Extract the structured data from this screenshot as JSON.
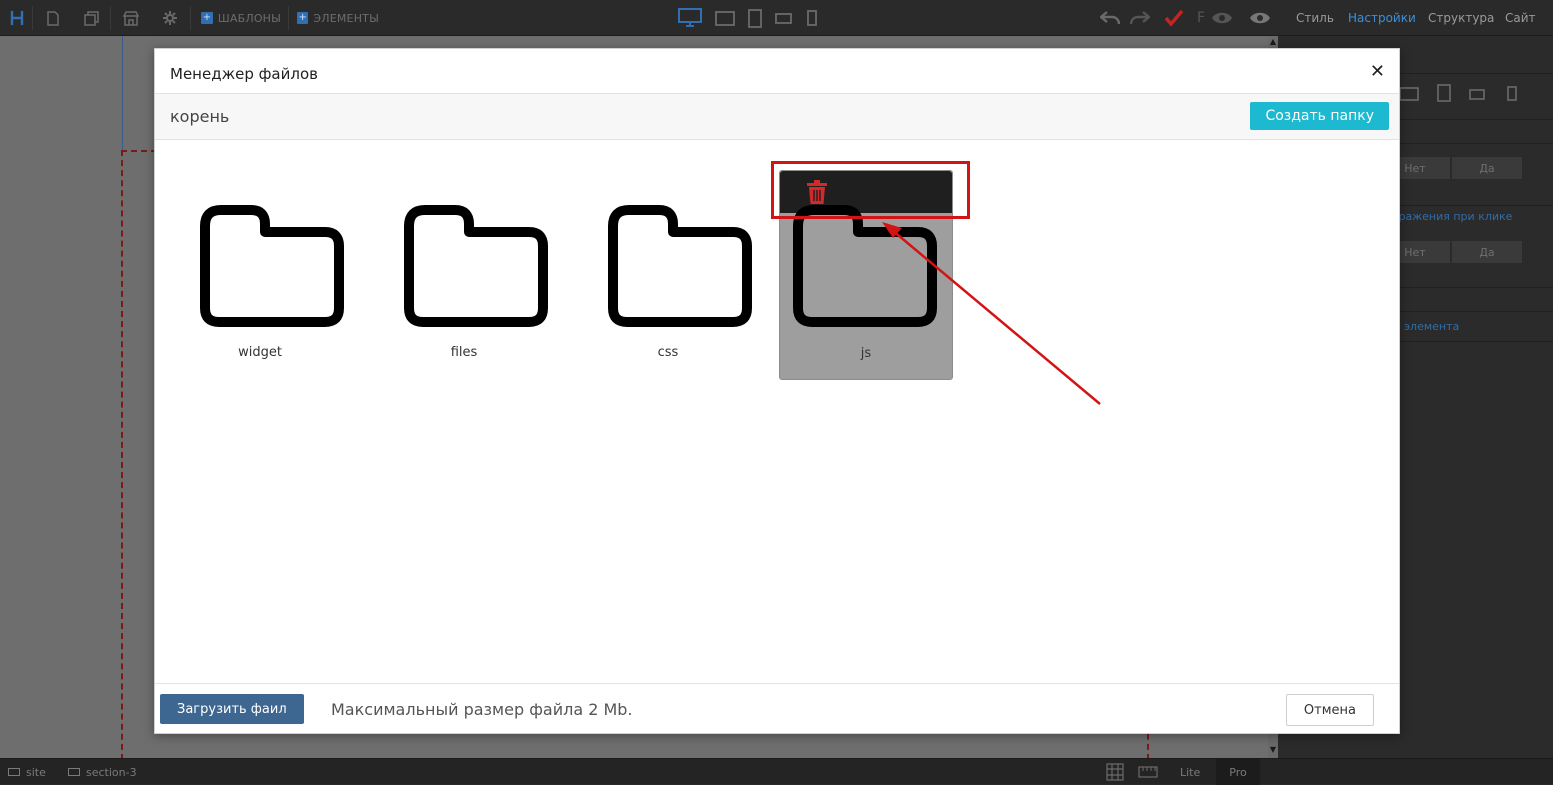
{
  "toolbar": {
    "templates_label": "ШАБЛОНЫ",
    "elements_label": "ЭЛЕМЕНТЫ",
    "letter_f": "F",
    "tabs": [
      {
        "label": "Стиль"
      },
      {
        "label": "Настройки"
      },
      {
        "label": "Структура"
      },
      {
        "label": "Сайт"
      }
    ]
  },
  "right_panel": {
    "option_no": "Нет",
    "option_yes": "Да",
    "image_click_label": "ображения при клике",
    "element_label": "элемента"
  },
  "statusbar": {
    "crumb_site": "site",
    "crumb_section": "section-3",
    "lite_label": "Lite",
    "pro_label": "Pro"
  },
  "modal": {
    "title": "Менеджер файлов",
    "breadcrumb": "корень",
    "create_folder_label": "Создать папку",
    "folders": [
      {
        "name": "widget"
      },
      {
        "name": "files"
      },
      {
        "name": "css"
      },
      {
        "name": "js"
      }
    ],
    "upload_label": "Загрузить фаил",
    "max_size_text": "Максимальный размер файла 2 Mb.",
    "cancel_label": "Отмена"
  },
  "colors": {
    "accent_create": "#1cb9d0",
    "upload_button": "#3d6690",
    "highlight": "#d21414",
    "delete_icon": "#d12a2a"
  }
}
